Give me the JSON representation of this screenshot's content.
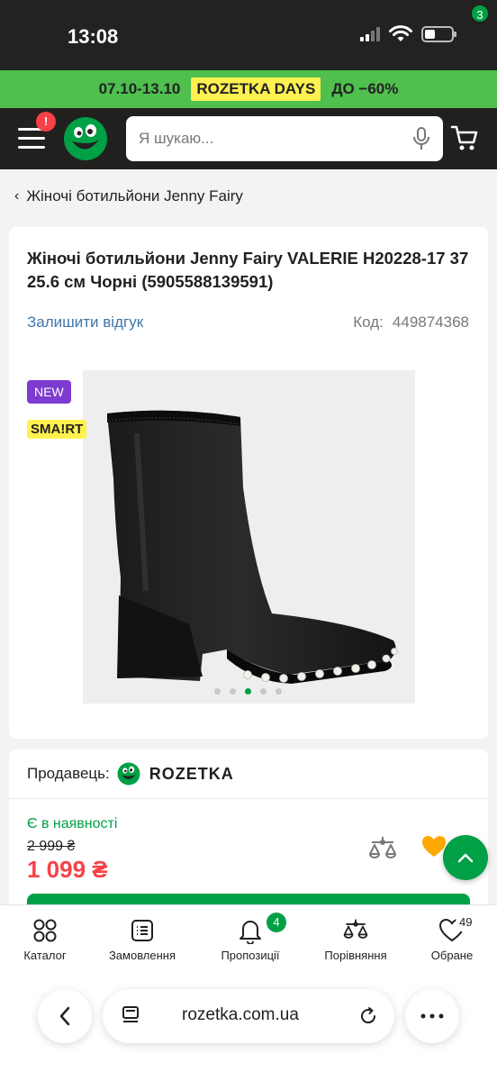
{
  "status_bar": {
    "time": "13:08",
    "battery_level": 0.35
  },
  "promo": {
    "dates": "07.10-13.10",
    "tag": "ROZETKA DAYS",
    "discount": "ДО −60%"
  },
  "header": {
    "menu_badge": "!",
    "search_placeholder": "Я шукаю...",
    "cart_count": "3"
  },
  "breadcrumb": {
    "label": "Жіночі ботильйони Jenny Fairy"
  },
  "product": {
    "title": "Жіночі ботильйони Jenny Fairy VALERIE H20228-17 37 25.6 см Чорні (5905588139591)",
    "review_link": "Залишити відгук",
    "code_label": "Код:",
    "code_value": "449874368",
    "badge_new": "NEW",
    "badge_smart": "SMA!RT",
    "gallery_count": 5,
    "gallery_active": 3
  },
  "seller": {
    "label": "Продавець:",
    "name": "ROZETKA",
    "availability": "Є в наявності",
    "old_price": "2 999 ₴",
    "price": "1 099 ₴"
  },
  "bottom_nav": {
    "items": [
      {
        "label": "Каталог",
        "icon": "catalog-icon"
      },
      {
        "label": "Замовлення",
        "icon": "orders-icon"
      },
      {
        "label": "Пропозиції",
        "icon": "bell-icon",
        "badge": "4"
      },
      {
        "label": "Порівняння",
        "icon": "scales-icon"
      },
      {
        "label": "Обране",
        "icon": "heart-icon",
        "badge": "49"
      }
    ]
  },
  "browser": {
    "url": "rozetka.com.ua"
  },
  "colors": {
    "brand_green": "#00a046",
    "promo_green": "#4fbf4e",
    "header_dark": "#221f1f",
    "price_red": "#f84147",
    "link_blue": "#3e77aa",
    "new_purple": "#7d3bd1",
    "smart_yellow": "#fff14f"
  }
}
